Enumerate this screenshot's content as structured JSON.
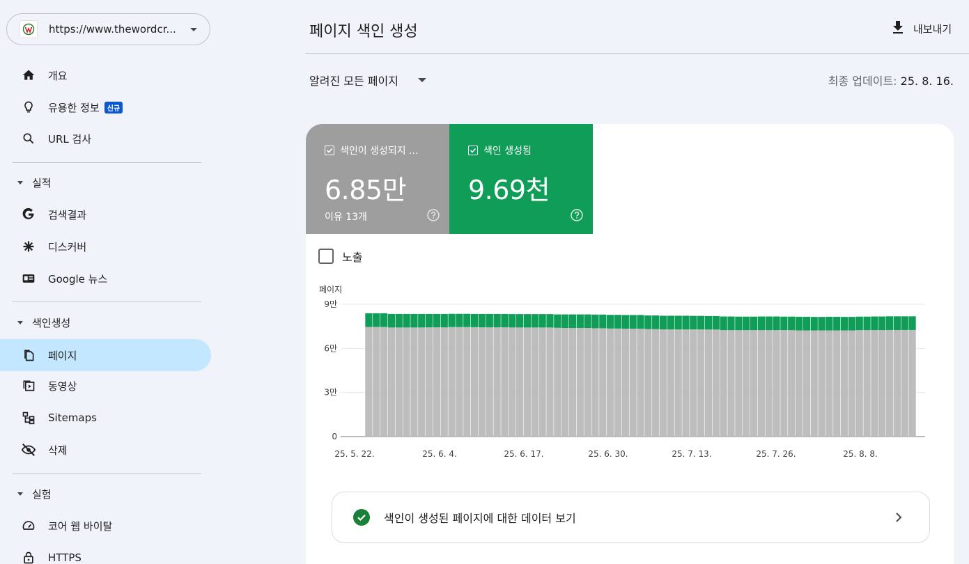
{
  "sidebar": {
    "property_url": "https://www.thewordcr...",
    "items": [
      {
        "label": "개요",
        "icon": "home-icon"
      },
      {
        "label": "유용한 정보",
        "icon": "lightbulb-icon",
        "badge": "신규"
      },
      {
        "label": "URL 검사",
        "icon": "search-icon"
      }
    ],
    "sections": [
      {
        "label": "실적",
        "items": [
          {
            "label": "검색결과",
            "icon": "google-g-icon"
          },
          {
            "label": "디스커버",
            "icon": "asterisk-icon"
          },
          {
            "label": "Google 뉴스",
            "icon": "news-icon"
          }
        ]
      },
      {
        "label": "색인생성",
        "items": [
          {
            "label": "페이지",
            "icon": "pages-icon",
            "active": true
          },
          {
            "label": "동영상",
            "icon": "video-icon"
          },
          {
            "label": "Sitemaps",
            "icon": "sitemap-icon"
          },
          {
            "label": "삭제",
            "icon": "eye-off-icon"
          }
        ]
      },
      {
        "label": "실험",
        "items": [
          {
            "label": "코어 웹 바이탈",
            "icon": "gauge-icon"
          },
          {
            "label": "HTTPS",
            "icon": "lock-icon"
          }
        ]
      }
    ]
  },
  "header": {
    "title": "페이지 색인 생성",
    "export_label": "내보내기"
  },
  "filter": {
    "selected": "알려진 모든 페이지"
  },
  "updated": {
    "label": "최종 업데이트:",
    "value": "25. 8. 16."
  },
  "tiles": {
    "not_indexed": {
      "label": "색인이 생성되지 ...",
      "value": "6.85만",
      "sub": "이유 13개"
    },
    "indexed": {
      "label": "색인 생성됨",
      "value": "9.69천"
    }
  },
  "impressions_label": "노출",
  "data_row_label": "색인이 생성된 페이지에 대한 데이터 보기",
  "colors": {
    "not_indexed": "#bdbdbd",
    "indexed": "#0f9d58",
    "active_nav": "#c2e7ff"
  },
  "chart_data": {
    "type": "bar",
    "stacked": true,
    "ylabel": "페이지",
    "y_ticks": [
      "0",
      "3만",
      "6만",
      "9만"
    ],
    "ylim": [
      0,
      90000
    ],
    "x_tick_labels": [
      "25. 5. 22.",
      "25. 6. 4.",
      "25. 6. 17.",
      "25. 6. 30.",
      "25. 7. 13.",
      "25. 7. 26.",
      "25. 8. 8."
    ],
    "series": [
      {
        "name": "색인이 생성되지 않음",
        "color": "#bdbdbd",
        "values": [
          74600,
          74600,
          74600,
          74200,
          74200,
          74200,
          74200,
          74200,
          74300,
          74300,
          74300,
          74500,
          74500,
          74500,
          74400,
          74300,
          74300,
          74300,
          74300,
          74200,
          74200,
          74200,
          74200,
          74200,
          74200,
          74000,
          73900,
          73900,
          73900,
          73900,
          73700,
          73700,
          73500,
          73500,
          73400,
          73400,
          73400,
          73100,
          73100,
          72900,
          72900,
          72900,
          72900,
          72900,
          72900,
          72800,
          72800,
          72400,
          72400,
          72400,
          72400,
          72400,
          72400,
          72400,
          72400,
          72400,
          72400,
          72200,
          72200,
          72200,
          72200,
          72200,
          72200,
          72200,
          72200,
          72400,
          72400,
          72400,
          72400,
          72500,
          72500,
          72500,
          72500
        ]
      },
      {
        "name": "색인 생성됨",
        "color": "#0f9d58",
        "values": [
          9300,
          9300,
          9300,
          9200,
          9200,
          9200,
          9200,
          9200,
          9100,
          9100,
          9100,
          9000,
          9000,
          9000,
          9000,
          9100,
          9100,
          9100,
          9100,
          9100,
          9100,
          9100,
          9100,
          9100,
          9100,
          9100,
          9200,
          9200,
          9200,
          9200,
          9300,
          9300,
          9300,
          9300,
          9300,
          9300,
          9300,
          9300,
          9300,
          9300,
          9300,
          9300,
          9300,
          9200,
          9200,
          9200,
          9200,
          9300,
          9300,
          9200,
          9200,
          9200,
          9300,
          9300,
          9300,
          9200,
          9200,
          9300,
          9300,
          9200,
          9200,
          9300,
          9300,
          9200,
          9200,
          9200,
          9200,
          9300,
          9300,
          9300,
          9300,
          9300,
          9300
        ]
      }
    ]
  }
}
